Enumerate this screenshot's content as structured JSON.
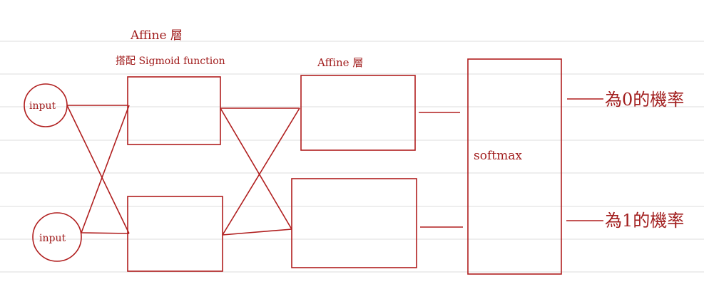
{
  "theme": {
    "ink": "#b01e1e",
    "ruled_line": "#dedede",
    "background": "#ffffff"
  },
  "labels": {
    "affine_1": "Affine 層",
    "affine_1_sub": "搭配 Sigmoid function",
    "affine_2": "Affine 層",
    "softmax": "softmax",
    "input_top": "input",
    "input_bottom": "input",
    "output_0": "為0的機率",
    "output_1": "為1的機率"
  }
}
